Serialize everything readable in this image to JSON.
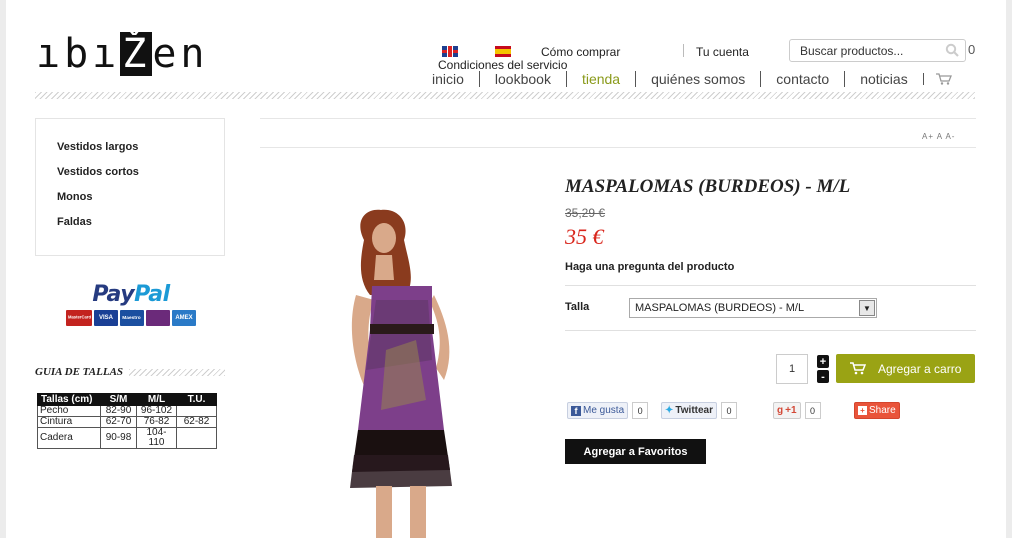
{
  "brand": {
    "logo_pre": "ıbı",
    "logo_z": "Ž",
    "logo_post": "en"
  },
  "header": {
    "languages": [
      {
        "name": "English",
        "icon": "uk-flag-icon"
      },
      {
        "name": "Español",
        "icon": "spain-flag-icon"
      }
    ],
    "links": {
      "how_to_buy": "Cómo comprar",
      "terms": "Condiciones del servicio",
      "account": "Tu cuenta"
    },
    "search": {
      "placeholder": "Buscar productos..."
    },
    "cart_count": "0",
    "nav": [
      "inicio",
      "lookbook",
      "tienda",
      "quiénes somos",
      "contacto",
      "noticias"
    ],
    "nav_active": "tienda",
    "accent_color": "#8a9a1a"
  },
  "sidebar": {
    "categories": [
      "Vestidos largos",
      "Vestidos cortos",
      "Monos",
      "Faldas"
    ],
    "paypal": {
      "pay": "Pay",
      "pal": "Pal",
      "cards": [
        "MasterCard",
        "VISA",
        "Maestro",
        "",
        "AMEX"
      ]
    },
    "size_guide": {
      "title": "GUIA DE TALLAS",
      "headers": [
        "Tallas (cm)",
        "S/M",
        "M/L",
        "T.U."
      ],
      "rows": [
        [
          "Pecho",
          "82-90",
          "96-102",
          ""
        ],
        [
          "Cintura",
          "62-70",
          "76-82",
          "62-82"
        ],
        [
          "Cadera",
          "90-98",
          "104-110",
          ""
        ]
      ]
    }
  },
  "product": {
    "font_size_controls": "A+ A A-",
    "title": "MASPALOMAS (BURDEOS) - M/L",
    "old_price": "35,29 €",
    "price": "35 €",
    "price_color": "#d9261c",
    "ask_question": "Haga una pregunta del producto",
    "size_label": "Talla",
    "size_selected": "MASPALOMAS (BURDEOS) - M/L",
    "quantity": "1",
    "qty_plus": "+",
    "qty_minus": "-",
    "add_to_cart": "Agregar a carro",
    "add_to_cart_color": "#9aa314",
    "social": {
      "facebook": {
        "label": "Me gusta",
        "count": "0"
      },
      "twitter": {
        "label": "Twittear",
        "count": "0"
      },
      "gplus": {
        "label": "+1",
        "count": "0"
      },
      "share": {
        "label": "Share"
      }
    },
    "add_to_favorites": "Agregar a Favoritos"
  }
}
